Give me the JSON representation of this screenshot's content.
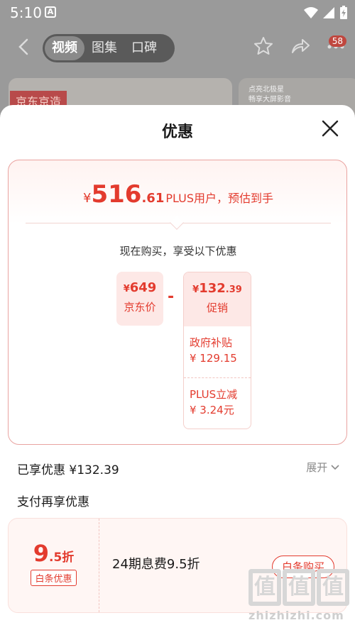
{
  "status_bar": {
    "time": "5:10",
    "app_indicator": "A"
  },
  "nav": {
    "tabs": [
      "视频",
      "图集",
      "口碑"
    ],
    "active_tab": 0,
    "badge_count": "58"
  },
  "background": {
    "card1_tag": "京东京造",
    "card2_text_line1": "点亮北极星",
    "card2_text_line2": "畅享大屏影音"
  },
  "sheet": {
    "title": "优惠",
    "estimate": {
      "currency": "¥",
      "integer": "516",
      "decimal": ".61",
      "label": "PLUS用户，预估到手"
    },
    "now_buy_text": "现在购买，享受以下优惠",
    "jd_price": {
      "currency": "¥",
      "value": "649",
      "label": "京东价"
    },
    "minus": "-",
    "promo": {
      "currency": "¥",
      "integer": "132",
      "decimal": ".39",
      "label": "促销"
    },
    "promo_items": [
      {
        "name": "政府补贴",
        "amount": "¥ 129.15"
      },
      {
        "name": "PLUS立减",
        "amount": "¥ 3.24元"
      }
    ],
    "enjoyed_text": "已享优惠 ¥132.39",
    "expand_label": "展开",
    "pay_title": "支付再享优惠",
    "pay_card": {
      "discount_num": "9",
      "discount_suffix": ".5折",
      "tag": "白条优惠",
      "description": "24期息费9.5折",
      "button": "白条购买"
    }
  },
  "watermark": {
    "chars": [
      "值",
      "值",
      "值"
    ],
    "url": "zhizhizhi.com"
  },
  "colors": {
    "accent": "#e33b2e",
    "bg_dim": "#9a9a9a"
  }
}
